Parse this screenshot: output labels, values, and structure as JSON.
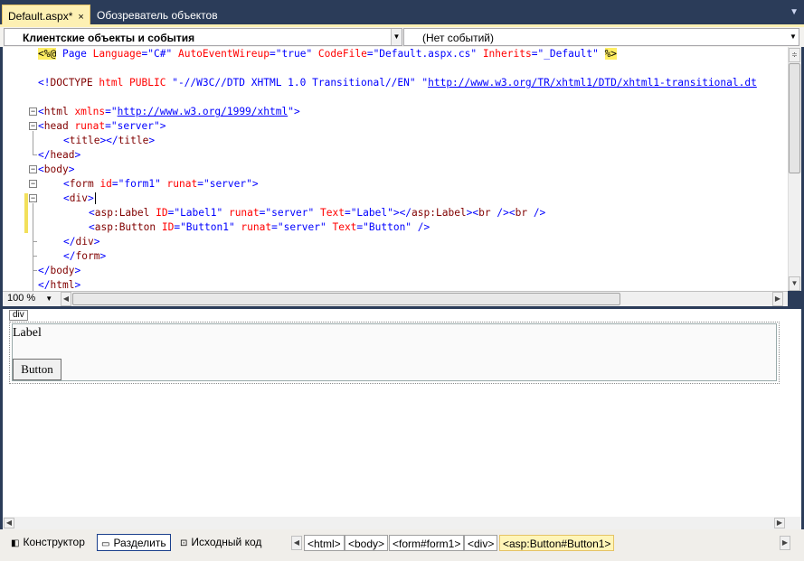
{
  "tabs": [
    {
      "label": "Default.aspx*",
      "close": "×"
    },
    {
      "label": "Обозреватель объектов"
    }
  ],
  "dropdowns": {
    "objects": "Клиентские объекты и события",
    "events": "(Нет событий)"
  },
  "code": {
    "l1": {
      "a": "<%@",
      "b": " Page ",
      "c": "Language",
      "d": "=",
      "e": "\"C#\"",
      "f": " AutoEventWireup",
      "g": "=",
      "h": "\"true\"",
      "i": " CodeFile",
      "j": "=",
      "k": "\"Default.aspx.cs\"",
      "l": " Inherits",
      "m": "=",
      "n": "\"_Default\"",
      "o": " ",
      "p": "%>"
    },
    "l3": {
      "a": "<!",
      "b": "DOCTYPE",
      "c": " html PUBLIC ",
      "d": "\"-//W3C//DTD XHTML 1.0 Transitional//EN\"",
      "e": " \"",
      "f": "http://www.w3.org/TR/xhtml1/DTD/xhtml1-transitional.dt"
    },
    "l5": {
      "a": "<",
      "b": "html",
      "c": " xmlns",
      "d": "=\"",
      "e": "http://www.w3.org/1999/xhtml",
      "f": "\">"
    },
    "l6": {
      "a": "<",
      "b": "head",
      "c": " runat",
      "d": "=\"server\">"
    },
    "l7": {
      "a": "<",
      "b": "title",
      "c": "></",
      "d": "title",
      "e": ">"
    },
    "l8": {
      "a": "</",
      "b": "head",
      "c": ">"
    },
    "l9": {
      "a": "<",
      "b": "body",
      "c": ">"
    },
    "l10": {
      "a": "<",
      "b": "form",
      "c": " id",
      "d": "=\"form1\"",
      "e": " runat",
      "f": "=\"server\">"
    },
    "l11": {
      "a": "<",
      "b": "div",
      "c": ">"
    },
    "l12": {
      "a": "<",
      "b": "asp:Label",
      "c": " ID",
      "d": "=\"Label1\"",
      "e": " runat",
      "f": "=\"server\"",
      "g": " Text",
      "h": "=\"Label\"></",
      "i": "asp:Label",
      "j": "><",
      "k": "br",
      "l": " /><",
      "m": "br",
      "n": " />"
    },
    "l13": {
      "a": "<",
      "b": "asp:Button",
      "c": " ID",
      "d": "=\"Button1\"",
      "e": " runat",
      "f": "=\"server\"",
      "g": " Text",
      "h": "=\"Button\"",
      "i": " />"
    },
    "l14": {
      "a": "</",
      "b": "div",
      "c": ">"
    },
    "l15": {
      "a": "</",
      "b": "form",
      "c": ">"
    },
    "l16": {
      "a": "</",
      "b": "body",
      "c": ">"
    },
    "l17": {
      "a": "</",
      "b": "html",
      "c": ">"
    }
  },
  "zoom": "100 %",
  "design": {
    "div_tag": "div",
    "label_text": "Label",
    "button_text": "Button"
  },
  "bottom": {
    "views": [
      "Конструктор",
      "Разделить",
      "Исходный код"
    ],
    "crumbs": [
      "<html>",
      "<body>",
      "<form#form1>",
      "<div>",
      "<asp:Button#Button1>"
    ]
  }
}
